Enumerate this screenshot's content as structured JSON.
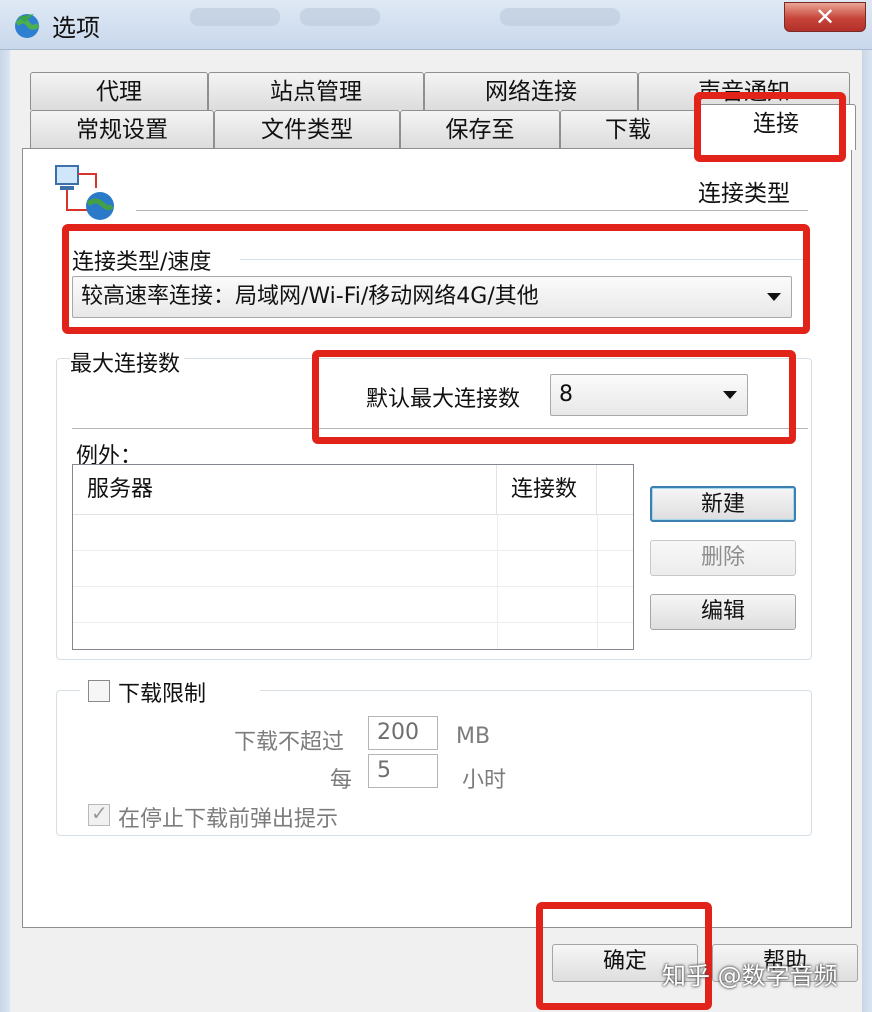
{
  "window": {
    "title": "选项",
    "close_glyph": "✕"
  },
  "tabs": {
    "row_back": [
      {
        "label": "代理"
      },
      {
        "label": "站点管理"
      },
      {
        "label": "网络连接"
      },
      {
        "label": "声音通知"
      }
    ],
    "row_front": [
      {
        "label": "常规设置"
      },
      {
        "label": "文件类型"
      },
      {
        "label": "保存至"
      },
      {
        "label": "下载"
      },
      {
        "label": "连接"
      }
    ],
    "active": "连接"
  },
  "section": {
    "title": "连接类型"
  },
  "connection_type": {
    "group_label": "连接类型/速度",
    "selected": "较高速率连接：局域网/Wi-Fi/移动网络4G/其他"
  },
  "max_connections": {
    "group_label": "最大连接数",
    "default_label": "默认最大连接数",
    "default_value": "8",
    "exceptions_label": "例外：",
    "columns": [
      "服务器",
      "连接数"
    ],
    "rows": [],
    "new_button": "新建",
    "delete_button": "删除",
    "edit_button": "编辑"
  },
  "download_limit": {
    "checkbox_label": "下载限制",
    "checked": false,
    "max_label": "下载不超过",
    "max_value": "200",
    "max_unit": "MB",
    "per_label": "每",
    "per_value": "5",
    "per_unit": "小时",
    "prompt_label": "在停止下载前弹出提示",
    "prompt_checked": true
  },
  "footer": {
    "ok_button": "确定",
    "help_button": "帮助"
  },
  "watermark": "知乎 @数字音频",
  "colors": {
    "highlight": "#e2231a",
    "focus_border": "#3c7fb1"
  }
}
